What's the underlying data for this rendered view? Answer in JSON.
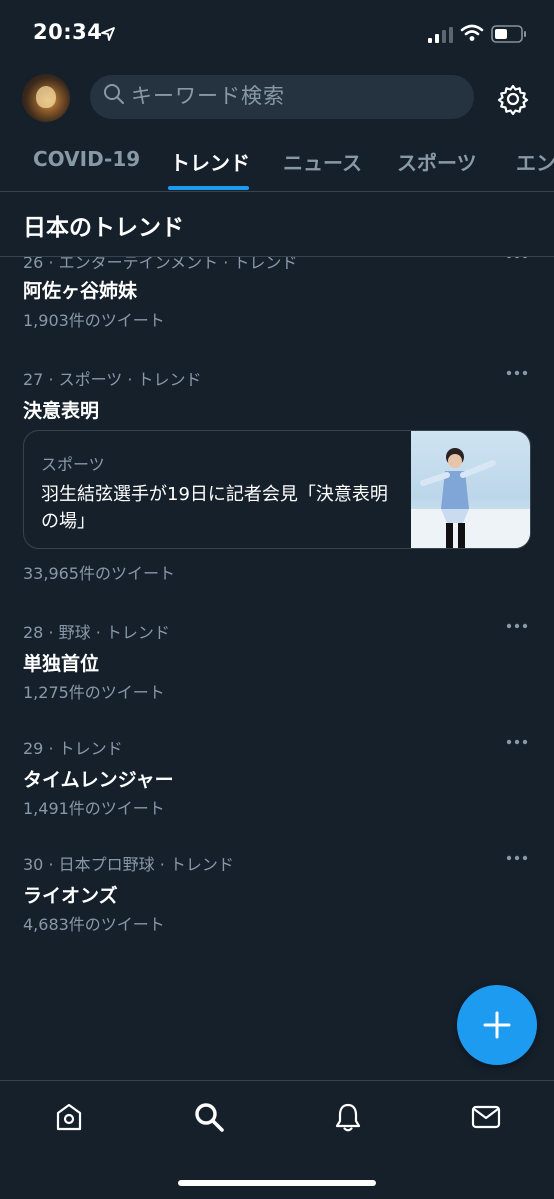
{
  "status_bar": {
    "time": "20:34",
    "icons": [
      "location-arrow-icon",
      "cellular-signal-icon",
      "wifi-icon",
      "battery-icon"
    ]
  },
  "header": {
    "avatar": "profile-avatar",
    "search_placeholder": "キーワード検索",
    "icons": [
      "search-icon",
      "gear-icon"
    ]
  },
  "tabs": [
    {
      "label": "COVID-19",
      "active": false
    },
    {
      "label": "トレンド",
      "active": true
    },
    {
      "label": "ニュース",
      "active": false
    },
    {
      "label": "スポーツ",
      "active": false
    },
    {
      "label": "エン",
      "active": false
    }
  ],
  "section_title": "日本のトレンド",
  "trends": [
    {
      "meta": "26 · エンターテインメント · トレンド",
      "name": "阿佐ヶ谷姉妹",
      "count": "1,903件のツイート"
    },
    {
      "meta": "27 · スポーツ · トレンド",
      "name": "決意表明",
      "count": "33,965件のツイート",
      "news": {
        "category": "スポーツ",
        "headline": "羽生結弦選手が19日に記者会見「決意表明の場」"
      }
    },
    {
      "meta": "28 · 野球 · トレンド",
      "name": "単独首位",
      "count": "1,275件のツイート"
    },
    {
      "meta": "29 · トレンド",
      "name": "タイムレンジャー",
      "count": "1,491件のツイート"
    },
    {
      "meta": "30 · 日本プロ野球 · トレンド",
      "name": "ライオンズ",
      "count": "4,683件のツイート"
    }
  ],
  "fab": {
    "icon": "plus-icon"
  },
  "bottom_nav": [
    "home-icon",
    "search-icon",
    "notifications-bell-icon",
    "messages-envelope-icon"
  ],
  "colors": {
    "background": "#15202b",
    "accent": "#1d9bf0",
    "secondary_text": "#8899a6",
    "divider": "#38444d",
    "search_bg": "#253341"
  }
}
